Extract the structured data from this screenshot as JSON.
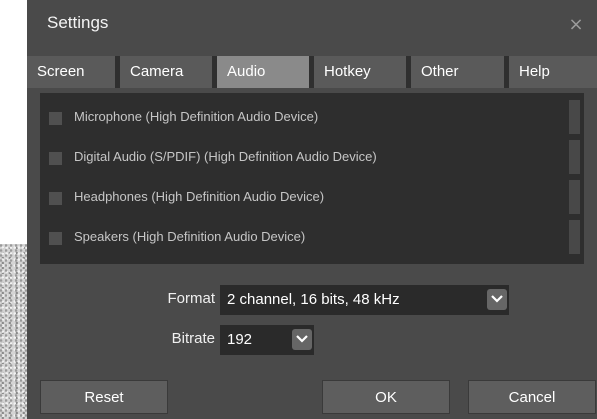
{
  "window": {
    "title": "Settings",
    "close_glyph": "×"
  },
  "tabs": [
    {
      "label": "Screen",
      "active": false
    },
    {
      "label": "Camera",
      "active": false
    },
    {
      "label": "Audio",
      "active": true
    },
    {
      "label": "Hotkey",
      "active": false
    },
    {
      "label": "Other",
      "active": false
    },
    {
      "label": "Help",
      "active": false
    }
  ],
  "devices": [
    {
      "label": "Microphone (High Definition Audio Device)",
      "checked": false
    },
    {
      "label": "Digital Audio (S/PDIF) (High Definition Audio Device)",
      "checked": false
    },
    {
      "label": "Headphones (High Definition Audio Device)",
      "checked": false
    },
    {
      "label": "Speakers (High Definition Audio Device)",
      "checked": false
    }
  ],
  "format": {
    "label": "Format",
    "value": "2 channel, 16 bits, 48 kHz"
  },
  "bitrate": {
    "label": "Bitrate",
    "value": "192"
  },
  "buttons": {
    "reset": "Reset",
    "ok": "OK",
    "cancel": "Cancel"
  },
  "icons": {
    "close": "close-icon",
    "dropdown": "chevron-down-icon"
  },
  "colors": {
    "window_bg": "#4a4a4a",
    "panel_bg": "#2e2e2e",
    "active_tab": "#8a8a8a",
    "tab": "#5a5a5a"
  }
}
